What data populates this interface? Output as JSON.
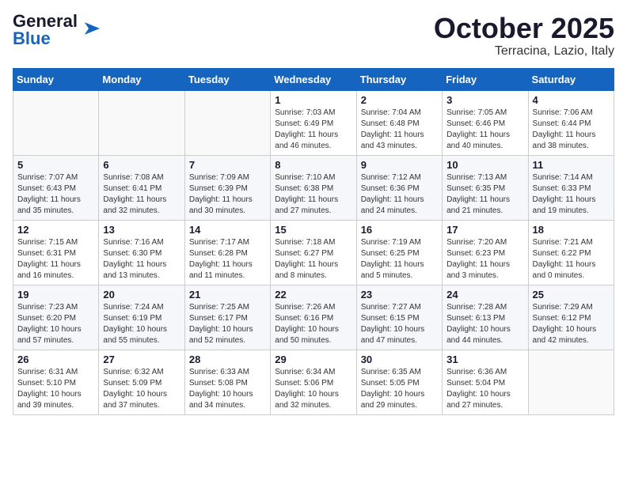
{
  "header": {
    "logo_general": "General",
    "logo_blue": "Blue",
    "title": "October 2025",
    "subtitle": "Terracina, Lazio, Italy"
  },
  "weekdays": [
    "Sunday",
    "Monday",
    "Tuesday",
    "Wednesday",
    "Thursday",
    "Friday",
    "Saturday"
  ],
  "weeks": [
    [
      {
        "day": "",
        "info": ""
      },
      {
        "day": "",
        "info": ""
      },
      {
        "day": "",
        "info": ""
      },
      {
        "day": "1",
        "info": "Sunrise: 7:03 AM\nSunset: 6:49 PM\nDaylight: 11 hours\nand 46 minutes."
      },
      {
        "day": "2",
        "info": "Sunrise: 7:04 AM\nSunset: 6:48 PM\nDaylight: 11 hours\nand 43 minutes."
      },
      {
        "day": "3",
        "info": "Sunrise: 7:05 AM\nSunset: 6:46 PM\nDaylight: 11 hours\nand 40 minutes."
      },
      {
        "day": "4",
        "info": "Sunrise: 7:06 AM\nSunset: 6:44 PM\nDaylight: 11 hours\nand 38 minutes."
      }
    ],
    [
      {
        "day": "5",
        "info": "Sunrise: 7:07 AM\nSunset: 6:43 PM\nDaylight: 11 hours\nand 35 minutes."
      },
      {
        "day": "6",
        "info": "Sunrise: 7:08 AM\nSunset: 6:41 PM\nDaylight: 11 hours\nand 32 minutes."
      },
      {
        "day": "7",
        "info": "Sunrise: 7:09 AM\nSunset: 6:39 PM\nDaylight: 11 hours\nand 30 minutes."
      },
      {
        "day": "8",
        "info": "Sunrise: 7:10 AM\nSunset: 6:38 PM\nDaylight: 11 hours\nand 27 minutes."
      },
      {
        "day": "9",
        "info": "Sunrise: 7:12 AM\nSunset: 6:36 PM\nDaylight: 11 hours\nand 24 minutes."
      },
      {
        "day": "10",
        "info": "Sunrise: 7:13 AM\nSunset: 6:35 PM\nDaylight: 11 hours\nand 21 minutes."
      },
      {
        "day": "11",
        "info": "Sunrise: 7:14 AM\nSunset: 6:33 PM\nDaylight: 11 hours\nand 19 minutes."
      }
    ],
    [
      {
        "day": "12",
        "info": "Sunrise: 7:15 AM\nSunset: 6:31 PM\nDaylight: 11 hours\nand 16 minutes."
      },
      {
        "day": "13",
        "info": "Sunrise: 7:16 AM\nSunset: 6:30 PM\nDaylight: 11 hours\nand 13 minutes."
      },
      {
        "day": "14",
        "info": "Sunrise: 7:17 AM\nSunset: 6:28 PM\nDaylight: 11 hours\nand 11 minutes."
      },
      {
        "day": "15",
        "info": "Sunrise: 7:18 AM\nSunset: 6:27 PM\nDaylight: 11 hours\nand 8 minutes."
      },
      {
        "day": "16",
        "info": "Sunrise: 7:19 AM\nSunset: 6:25 PM\nDaylight: 11 hours\nand 5 minutes."
      },
      {
        "day": "17",
        "info": "Sunrise: 7:20 AM\nSunset: 6:23 PM\nDaylight: 11 hours\nand 3 minutes."
      },
      {
        "day": "18",
        "info": "Sunrise: 7:21 AM\nSunset: 6:22 PM\nDaylight: 11 hours\nand 0 minutes."
      }
    ],
    [
      {
        "day": "19",
        "info": "Sunrise: 7:23 AM\nSunset: 6:20 PM\nDaylight: 10 hours\nand 57 minutes."
      },
      {
        "day": "20",
        "info": "Sunrise: 7:24 AM\nSunset: 6:19 PM\nDaylight: 10 hours\nand 55 minutes."
      },
      {
        "day": "21",
        "info": "Sunrise: 7:25 AM\nSunset: 6:17 PM\nDaylight: 10 hours\nand 52 minutes."
      },
      {
        "day": "22",
        "info": "Sunrise: 7:26 AM\nSunset: 6:16 PM\nDaylight: 10 hours\nand 50 minutes."
      },
      {
        "day": "23",
        "info": "Sunrise: 7:27 AM\nSunset: 6:15 PM\nDaylight: 10 hours\nand 47 minutes."
      },
      {
        "day": "24",
        "info": "Sunrise: 7:28 AM\nSunset: 6:13 PM\nDaylight: 10 hours\nand 44 minutes."
      },
      {
        "day": "25",
        "info": "Sunrise: 7:29 AM\nSunset: 6:12 PM\nDaylight: 10 hours\nand 42 minutes."
      }
    ],
    [
      {
        "day": "26",
        "info": "Sunrise: 6:31 AM\nSunset: 5:10 PM\nDaylight: 10 hours\nand 39 minutes."
      },
      {
        "day": "27",
        "info": "Sunrise: 6:32 AM\nSunset: 5:09 PM\nDaylight: 10 hours\nand 37 minutes."
      },
      {
        "day": "28",
        "info": "Sunrise: 6:33 AM\nSunset: 5:08 PM\nDaylight: 10 hours\nand 34 minutes."
      },
      {
        "day": "29",
        "info": "Sunrise: 6:34 AM\nSunset: 5:06 PM\nDaylight: 10 hours\nand 32 minutes."
      },
      {
        "day": "30",
        "info": "Sunrise: 6:35 AM\nSunset: 5:05 PM\nDaylight: 10 hours\nand 29 minutes."
      },
      {
        "day": "31",
        "info": "Sunrise: 6:36 AM\nSunset: 5:04 PM\nDaylight: 10 hours\nand 27 minutes."
      },
      {
        "day": "",
        "info": ""
      }
    ]
  ]
}
